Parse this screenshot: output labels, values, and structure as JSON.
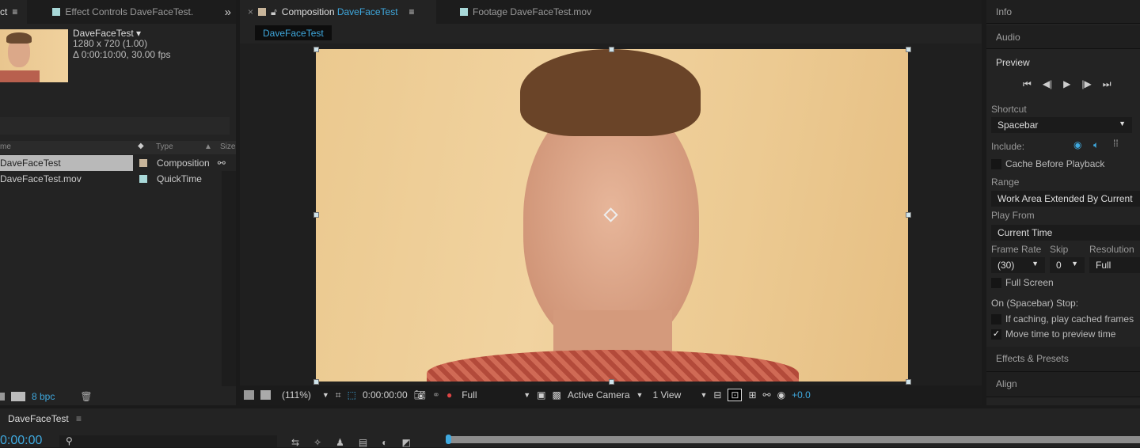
{
  "project_panel": {
    "tab_partial": "ct",
    "effect_controls_tab": "Effect Controls DaveFaceTest.",
    "overflow": "»",
    "item_name": "DaveFaceTest ▾",
    "item_dims": "1280 x 720 (1.00)",
    "item_duration": "Δ 0:00:10:00, 30.00 fps",
    "columns": {
      "name": "me",
      "type": "Type",
      "size": "Size"
    },
    "rows": [
      {
        "name": "DaveFaceTest",
        "type": "Composition",
        "selected": true,
        "color": "#c8b59a"
      },
      {
        "name": "DaveFaceTest.mov",
        "type": "QuickTime",
        "selected": false,
        "color": "#a8d8d8"
      }
    ],
    "bpc": "8 bpc"
  },
  "composition_panel": {
    "close": "×",
    "tab_prefix": "Composition",
    "tab_name": "DaveFaceTest",
    "footage_tab": "Footage DaveFaceTest.mov",
    "breadcrumb": "DaveFaceTest",
    "toolbar": {
      "zoom": "(111%)",
      "timecode": "0:00:00:00",
      "resolution": "Full",
      "camera": "Active Camera",
      "views": "1 View",
      "exposure": "+0.0"
    }
  },
  "right_panel": {
    "info": "Info",
    "audio": "Audio",
    "preview": "Preview",
    "shortcut_label": "Shortcut",
    "shortcut_value": "Spacebar",
    "include_label": "Include:",
    "cache_before": "Cache Before Playback",
    "range_label": "Range",
    "range_value": "Work Area Extended By Current",
    "play_from_label": "Play From",
    "play_from_value": "Current Time",
    "frame_rate_label": "Frame Rate",
    "skip_label": "Skip",
    "resolution_label": "Resolution",
    "frame_rate_value": "(30)",
    "skip_value": "0",
    "resolution_value": "Full",
    "full_screen": "Full Screen",
    "on_stop_label": "On (Spacebar) Stop:",
    "if_caching": "If caching, play cached frames",
    "move_time": "Move time to preview time",
    "move_time_checked": true,
    "effects_presets": "Effects & Presets",
    "align": "Align"
  },
  "timeline": {
    "tab": "DaveFaceTest",
    "timecode": "0:00:00"
  },
  "colors": {
    "accent": "#3fa9df",
    "panel": "#232323"
  }
}
